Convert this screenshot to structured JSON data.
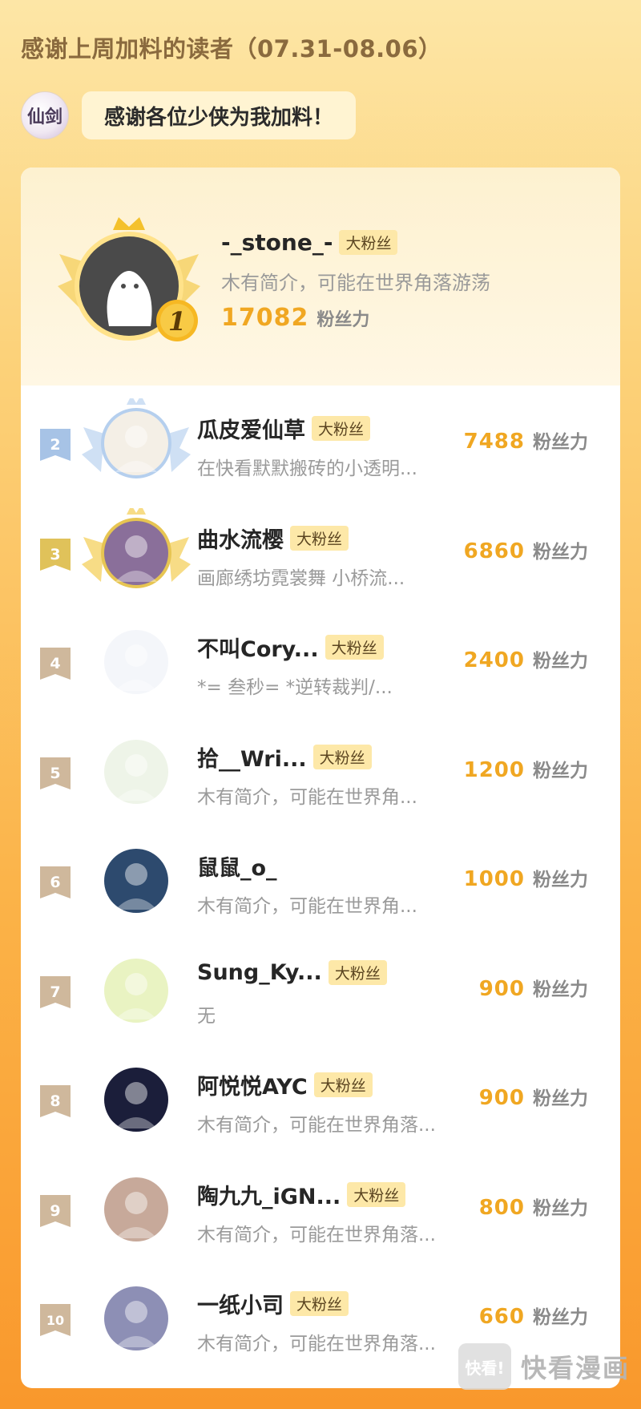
{
  "header": {
    "title": "感谢上周加料的读者（07.31-08.06）",
    "logo_text": "仙剑",
    "bubble": "感谢各位少侠为我加料！"
  },
  "badge_label": "大粉丝",
  "unit_label": "粉丝力",
  "top1": {
    "rank": "1",
    "name": "-_stone_-",
    "bio": "木有简介，可能在世界角落游荡",
    "score": "17082"
  },
  "rows": [
    {
      "rank": "2",
      "name": "瓜皮爱仙草",
      "bio": "在快看默默搬砖的小透明...",
      "score": "7488",
      "badge": true
    },
    {
      "rank": "3",
      "name": "曲水流樱",
      "bio": "画廊绣坊霓裳舞 小桥流...",
      "score": "6860",
      "badge": true
    },
    {
      "rank": "4",
      "name": "不叫Cory...",
      "bio": "*= 叁秒= *逆转裁判/...",
      "score": "2400",
      "badge": true
    },
    {
      "rank": "5",
      "name": "拾__Wri...",
      "bio": "木有简介，可能在世界角...",
      "score": "1200",
      "badge": true
    },
    {
      "rank": "6",
      "name": "鼠鼠_o_",
      "bio": "木有简介，可能在世界角...",
      "score": "1000",
      "badge": false
    },
    {
      "rank": "7",
      "name": "Sung_Ky...",
      "bio": "无",
      "score": "900",
      "badge": true
    },
    {
      "rank": "8",
      "name": "阿悦悦AYC",
      "bio": "木有简介，可能在世界角落...",
      "score": "900",
      "badge": true
    },
    {
      "rank": "9",
      "name": "陶九九_iGN...",
      "bio": "木有简介，可能在世界角落...",
      "score": "800",
      "badge": true
    },
    {
      "rank": "10",
      "name": "一纸小司",
      "bio": "木有简介，可能在世界角落...",
      "score": "660",
      "badge": true
    }
  ],
  "watermark": {
    "box_text": "快看!",
    "text": "快看漫画"
  },
  "colors": {
    "score": "#f0a722",
    "badge_bg": "#fde8a8",
    "rank2": "#a7c3e6",
    "rank3": "#e0c25a",
    "rank_other": "#cfb89c"
  }
}
